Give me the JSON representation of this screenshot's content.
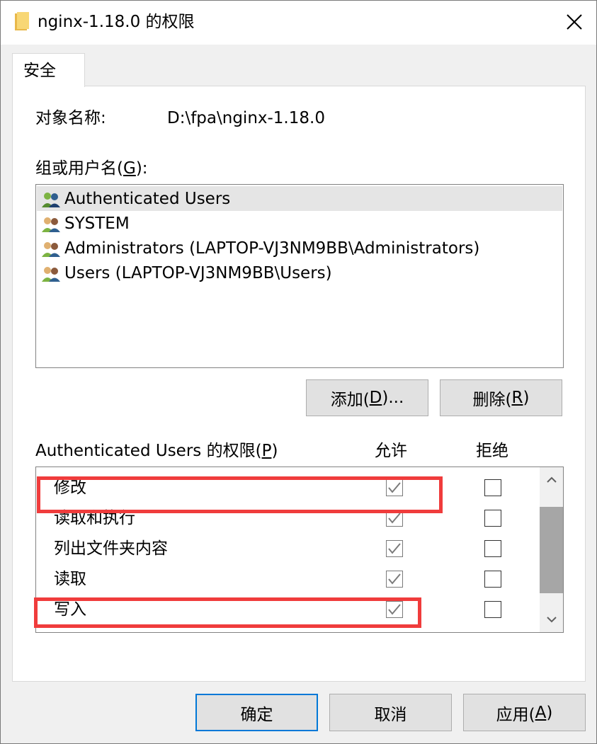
{
  "window": {
    "title": "nginx-1.18.0 的权限",
    "folder_icon": "folder-icon",
    "close_icon": "close-icon"
  },
  "tabs": [
    {
      "label": "安全",
      "active": true
    }
  ],
  "object": {
    "label": "对象名称:",
    "value": "D:\\fpa\\nginx-1.18.0"
  },
  "group_section": {
    "label_prefix": "组或用户名(",
    "label_accel": "G",
    "label_suffix": "):",
    "users": [
      {
        "name": "Authenticated Users",
        "icon": "users-group-icon",
        "selected": true
      },
      {
        "name": "SYSTEM",
        "icon": "users-group-icon",
        "selected": false
      },
      {
        "name": "Administrators (LAPTOP-VJ3NM9BB\\Administrators)",
        "icon": "users-group-icon",
        "selected": false
      },
      {
        "name": "Users (LAPTOP-VJ3NM9BB\\Users)",
        "icon": "users-group-icon",
        "selected": false
      }
    ]
  },
  "user_buttons": {
    "add_prefix": "添加(",
    "add_accel": "D",
    "add_suffix": ")...",
    "remove_prefix": "删除(",
    "remove_accel": "R",
    "remove_suffix": ")"
  },
  "permissions": {
    "label_prefix": "Authenticated Users 的权限(",
    "label_accel": "P",
    "label_suffix": ")",
    "allow_header": "允许",
    "deny_header": "拒绝",
    "rows": [
      {
        "name": "修改",
        "allow": true,
        "deny": false
      },
      {
        "name": "读取和执行",
        "allow": true,
        "deny": false
      },
      {
        "name": "列出文件夹内容",
        "allow": true,
        "deny": false
      },
      {
        "name": "读取",
        "allow": true,
        "deny": false
      },
      {
        "name": "写入",
        "allow": true,
        "deny": false
      }
    ]
  },
  "dialog_buttons": {
    "ok": "确定",
    "cancel": "取消",
    "apply_prefix": "应用(",
    "apply_accel": "A",
    "apply_suffix": ")"
  },
  "colors": {
    "highlight": "#f03c3c",
    "focus_border": "#0078d7",
    "selected_row": "#e5e5e5"
  }
}
